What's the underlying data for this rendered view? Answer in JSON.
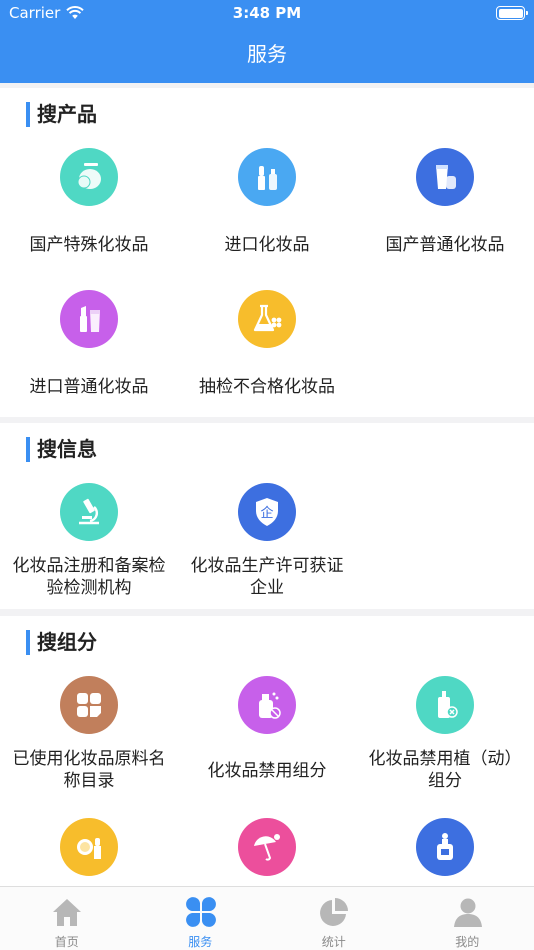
{
  "status_bar": {
    "carrier": "Carrier",
    "time": "3:48 PM"
  },
  "nav": {
    "title": "服务"
  },
  "sections": [
    {
      "title": "搜产品",
      "items": [
        {
          "label": "国产特殊化妆品",
          "icon": "compact-powder-icon",
          "color": "#4fd8c4"
        },
        {
          "label": "进口化妆品",
          "icon": "lipstick-bottle-icon",
          "color": "#4aa8f2"
        },
        {
          "label": "国产普通化妆品",
          "icon": "cream-tube-icon",
          "color": "#3d6fe0"
        },
        {
          "label": "进口普通化妆品",
          "icon": "lipstick-tube-icon",
          "color": "#c760ea"
        },
        {
          "label": "抽检不合格化妆品",
          "icon": "flask-icon",
          "color": "#f7bd2c"
        }
      ]
    },
    {
      "title": "搜信息",
      "items": [
        {
          "label": "化妆品注册和备案检验检测机构",
          "icon": "microscope-icon",
          "color": "#4fd8c4"
        },
        {
          "label": "化妆品生产许可获证企业",
          "icon": "enterprise-shield-icon",
          "color": "#3d6fe0"
        }
      ]
    },
    {
      "title": "搜组分",
      "items": [
        {
          "label": "已使用化妆品原料名称目录",
          "icon": "grid-catalog-icon",
          "color": "#c17f5c"
        },
        {
          "label": "化妆品禁用组分",
          "icon": "banned-spray-icon",
          "color": "#c760ea"
        },
        {
          "label": "化妆品禁用植（动）组分",
          "icon": "banned-bottle-icon",
          "color": "#4fd8c4"
        },
        {
          "label": "",
          "icon": "mirror-lipstick-icon",
          "color": "#f7bd2c"
        },
        {
          "label": "",
          "icon": "umbrella-sun-icon",
          "color": "#ec4f9c"
        },
        {
          "label": "",
          "icon": "perfume-bottle-icon",
          "color": "#3d6fe0"
        }
      ]
    }
  ],
  "tabs": [
    {
      "label": "首页",
      "icon": "home-icon",
      "active": false
    },
    {
      "label": "服务",
      "icon": "clover-icon",
      "active": true
    },
    {
      "label": "统计",
      "icon": "pie-chart-icon",
      "active": false
    },
    {
      "label": "我的",
      "icon": "user-icon",
      "active": false
    }
  ],
  "colors": {
    "primary": "#3a8ff2",
    "inactive_tab": "#8a8a8a"
  }
}
